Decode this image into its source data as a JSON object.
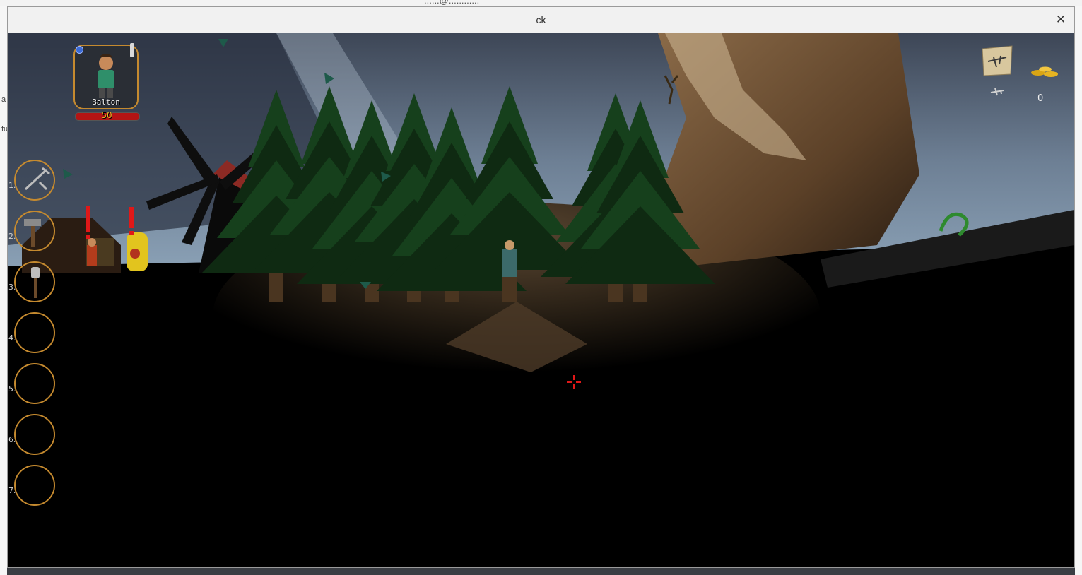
{
  "desktop": {
    "top_text": "......@............",
    "left_marks": [
      "a",
      "fu"
    ]
  },
  "window": {
    "title": "ck",
    "close_glyph": "✕"
  },
  "hud": {
    "character_name": "Balton",
    "health_value": "50",
    "health_fraction": 1.0,
    "hotbar": [
      {
        "number": "1.",
        "item": "pickaxe-shovel-icon"
      },
      {
        "number": "2.",
        "item": "hammer-icon"
      },
      {
        "number": "3.",
        "item": "shovel-icon"
      },
      {
        "number": "4.",
        "item": ""
      },
      {
        "number": "5.",
        "item": ""
      },
      {
        "number": "6.",
        "item": ""
      },
      {
        "number": "7.",
        "item": ""
      }
    ],
    "gold_count": "0",
    "colors": {
      "ring": "#c58a2f",
      "health": "#b31414",
      "health_text": "#e6b422",
      "crosshair": "#e01818"
    }
  }
}
